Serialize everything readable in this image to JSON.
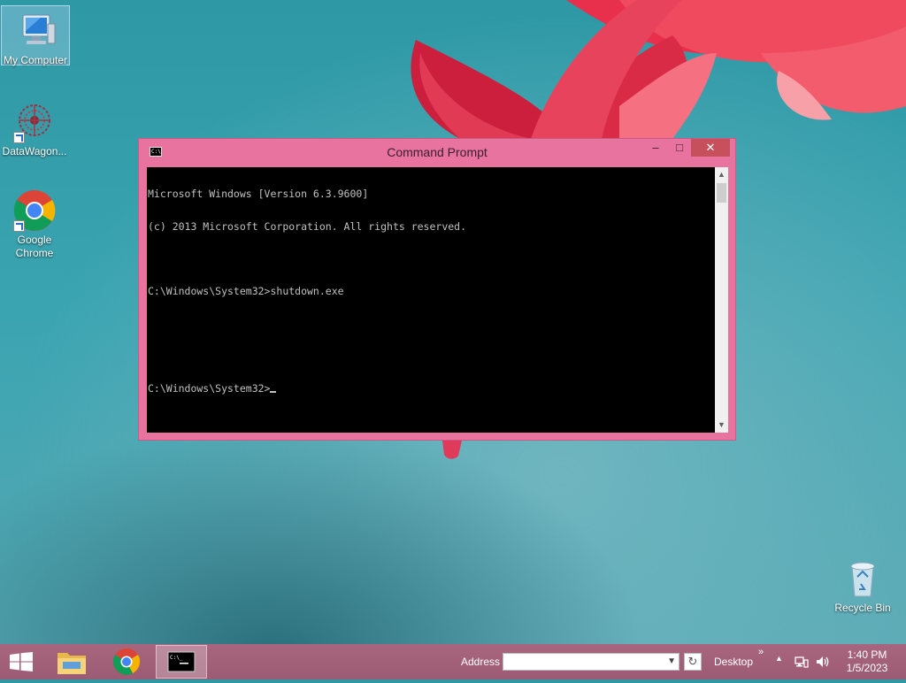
{
  "desktop": {
    "icons": [
      {
        "label": "My Computer"
      },
      {
        "label": "DataWagon..."
      },
      {
        "label": "Google Chrome"
      },
      {
        "label": "Recycle Bin"
      }
    ]
  },
  "window": {
    "title": "Command Prompt",
    "title_icon_text": "C:\\",
    "controls": {
      "minimize": "–",
      "maximize": "□",
      "close": "✕"
    },
    "console_lines": [
      "Microsoft Windows [Version 6.3.9600]",
      "(c) 2013 Microsoft Corporation. All rights reserved.",
      "",
      "C:\\Windows\\System32>shutdown.exe",
      "",
      "",
      "C:\\Windows\\System32>"
    ]
  },
  "taskbar": {
    "address_label": "Address",
    "address_value": "",
    "desktop_label": "Desktop",
    "chevron": "»",
    "tray_up": "▲",
    "clock_time": "1:40 PM",
    "clock_date": "1/5/2023"
  },
  "colors": {
    "window_frame": "#e8739f",
    "close_button": "#c7505d",
    "taskbar": "#a8667e",
    "desktop": "#3aa4b1"
  }
}
